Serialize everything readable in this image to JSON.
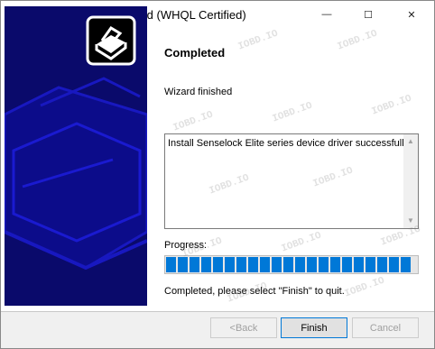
{
  "window": {
    "title": "Driver installation wizard (WHQL Certified)",
    "controls": {
      "minimize": "—",
      "maximize": "☐",
      "close": "✕"
    }
  },
  "page": {
    "heading": "Completed",
    "subheading": "Wizard finished",
    "log_lines": [
      "Install Senselock Elite series device driver successfully."
    ],
    "progress_label": "Progress:",
    "progress_fraction": 1.0,
    "status_text": "Completed, please select \"Finish\" to quit."
  },
  "buttons": {
    "back": "<Back",
    "finish": "Finish",
    "cancel": "Cancel"
  },
  "watermark": "IOBD.IO",
  "colors": {
    "side_panel": "#0a0a6b",
    "progress": "#0078d7"
  }
}
